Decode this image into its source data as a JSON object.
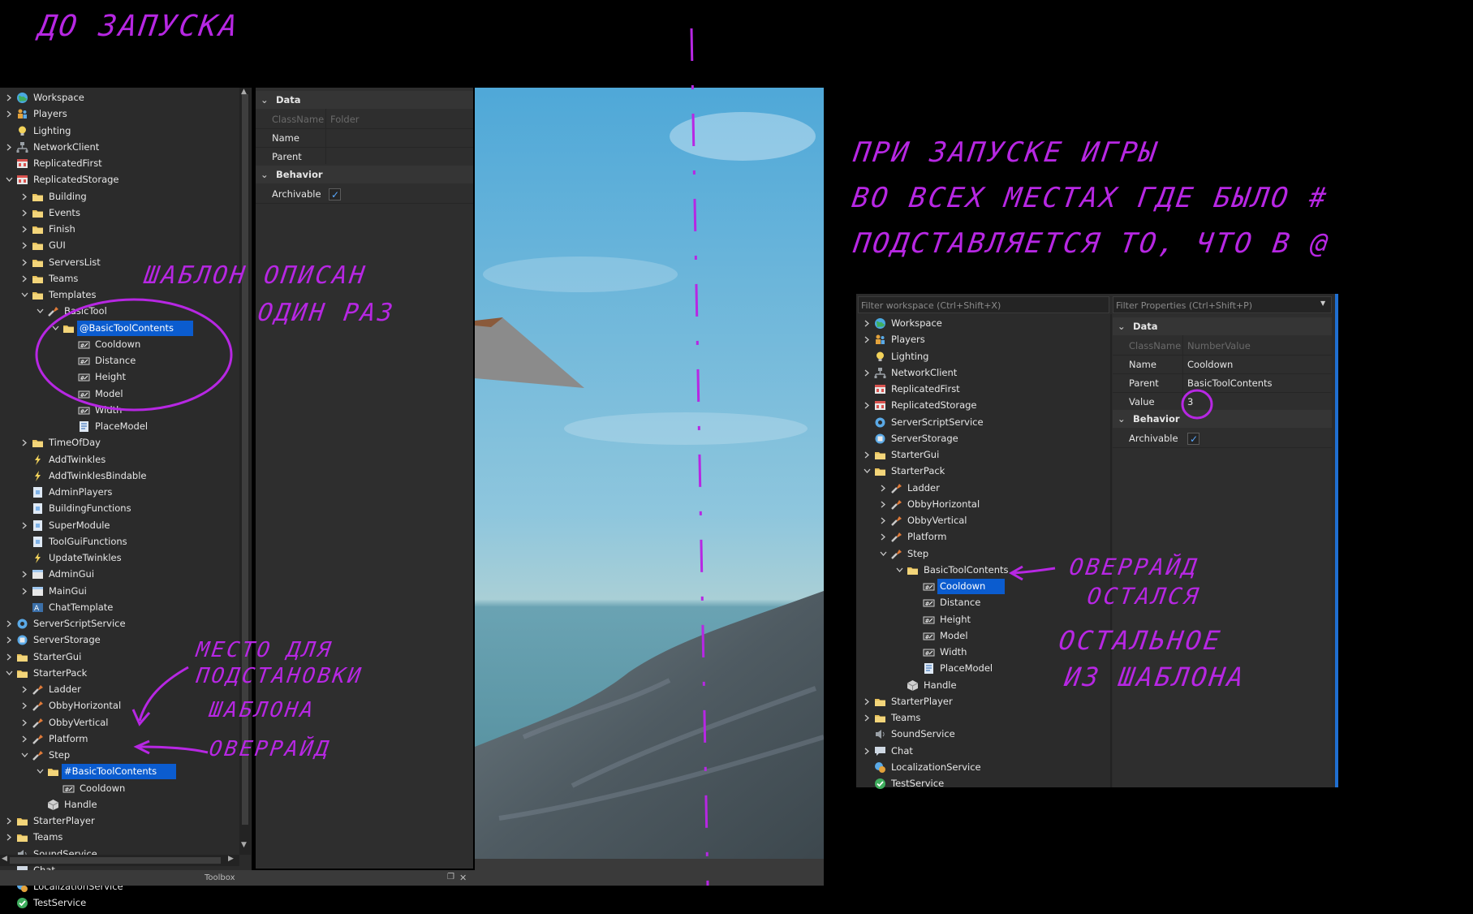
{
  "annotations": {
    "top_left": "ДО ЗАПУСКА",
    "right_line1": "ПРИ ЗАПУСКЕ ИГРЫ",
    "right_line2": "ВО ВСЕХ МЕСТАХ ГДЕ БЫЛО #",
    "right_line3": "ПОДСТАВЛЯЕТСЯ ТО, ЧТО В @",
    "template_note1": "ШАБЛОН ОПИСАН",
    "template_note2": "ОДИН РАЗ",
    "place_note1": "МЕСТО ДЛЯ",
    "place_note2": "ПОДСТАНОВКИ",
    "place_note3": "ШАБЛОНА",
    "override_note_left": "ОВЕРРАЙД",
    "override_right1": "ОВЕРРАЙД",
    "override_right2": "ОСТАЛСЯ",
    "override_right3": "ОСТАЛЬНОЕ",
    "override_right4": "ИЗ ШАБЛОНА"
  },
  "left_explorer": {
    "items": [
      {
        "label": "Workspace",
        "depth": 0,
        "arrow": "right",
        "icon": "globe-icon",
        "color": "#3fae5e"
      },
      {
        "label": "Players",
        "depth": 0,
        "arrow": "right",
        "icon": "players-icon",
        "color": "#e3a23c"
      },
      {
        "label": "Lighting",
        "depth": 0,
        "arrow": "none",
        "icon": "lightbulb-icon",
        "color": "#f2d25a"
      },
      {
        "label": "NetworkClient",
        "depth": 0,
        "arrow": "right",
        "icon": "network-icon",
        "color": "#9aa0a6"
      },
      {
        "label": "ReplicatedFirst",
        "depth": 0,
        "arrow": "none",
        "icon": "replicated-icon",
        "color": "#d9534f"
      },
      {
        "label": "ReplicatedStorage",
        "depth": 0,
        "arrow": "down",
        "icon": "replicated-icon",
        "color": "#d9534f"
      },
      {
        "label": "Building",
        "depth": 1,
        "arrow": "right",
        "icon": "folder-icon",
        "color": "#e8c15a"
      },
      {
        "label": "Events",
        "depth": 1,
        "arrow": "right",
        "icon": "folder-icon",
        "color": "#e8c15a"
      },
      {
        "label": "Finish",
        "depth": 1,
        "arrow": "right",
        "icon": "folder-icon",
        "color": "#e8c15a"
      },
      {
        "label": "GUI",
        "depth": 1,
        "arrow": "right",
        "icon": "folder-icon",
        "color": "#e8c15a"
      },
      {
        "label": "ServersList",
        "depth": 1,
        "arrow": "right",
        "icon": "folder-icon",
        "color": "#e8c15a"
      },
      {
        "label": "Teams",
        "depth": 1,
        "arrow": "right",
        "icon": "folder-icon",
        "color": "#e8c15a"
      },
      {
        "label": "Templates",
        "depth": 1,
        "arrow": "down",
        "icon": "folder-icon",
        "color": "#e8c15a"
      },
      {
        "label": "BasicTool",
        "depth": 2,
        "arrow": "down",
        "icon": "tool-icon",
        "color": "#e07b39"
      },
      {
        "label": "@BasicToolContents",
        "depth": 3,
        "arrow": "down",
        "icon": "folder-icon",
        "color": "#e8c15a",
        "selected": true
      },
      {
        "label": "Cooldown",
        "depth": 4,
        "arrow": "none",
        "icon": "number-value-icon",
        "color": "#cfcfcf"
      },
      {
        "label": "Distance",
        "depth": 4,
        "arrow": "none",
        "icon": "number-value-icon",
        "color": "#cfcfcf"
      },
      {
        "label": "Height",
        "depth": 4,
        "arrow": "none",
        "icon": "number-value-icon",
        "color": "#cfcfcf"
      },
      {
        "label": "Model",
        "depth": 4,
        "arrow": "none",
        "icon": "number-value-icon",
        "color": "#cfcfcf"
      },
      {
        "label": "Width",
        "depth": 4,
        "arrow": "none",
        "icon": "number-value-icon",
        "color": "#cfcfcf"
      },
      {
        "label": "PlaceModel",
        "depth": 4,
        "arrow": "none",
        "icon": "script-icon",
        "color": "#7fb3e8"
      },
      {
        "label": "TimeOfDay",
        "depth": 1,
        "arrow": "right",
        "icon": "folder-icon",
        "color": "#e8c15a"
      },
      {
        "label": "AddTwinkles",
        "depth": 1,
        "arrow": "none",
        "icon": "bindable-icon",
        "color": "#f2d25a"
      },
      {
        "label": "AddTwinklesBindable",
        "depth": 1,
        "arrow": "none",
        "icon": "bindable-icon",
        "color": "#f2d25a"
      },
      {
        "label": "AdminPlayers",
        "depth": 1,
        "arrow": "none",
        "icon": "module-icon",
        "color": "#7fb3e8"
      },
      {
        "label": "BuildingFunctions",
        "depth": 1,
        "arrow": "none",
        "icon": "module-icon",
        "color": "#7fb3e8"
      },
      {
        "label": "SuperModule",
        "depth": 1,
        "arrow": "right",
        "icon": "module-icon",
        "color": "#7fb3e8"
      },
      {
        "label": "ToolGuiFunctions",
        "depth": 1,
        "arrow": "none",
        "icon": "module-icon",
        "color": "#7fb3e8"
      },
      {
        "label": "UpdateTwinkles",
        "depth": 1,
        "arrow": "none",
        "icon": "bindable-icon",
        "color": "#f2d25a"
      },
      {
        "label": "AdminGui",
        "depth": 1,
        "arrow": "right",
        "icon": "screen-gui-icon",
        "color": "#9fc7ef"
      },
      {
        "label": "MainGui",
        "depth": 1,
        "arrow": "right",
        "icon": "screen-gui-icon",
        "color": "#9fc7ef"
      },
      {
        "label": "ChatTemplate",
        "depth": 1,
        "arrow": "none",
        "icon": "text-icon",
        "color": "#9fc7ef"
      },
      {
        "label": "ServerScriptService",
        "depth": 0,
        "arrow": "right",
        "icon": "server-script-icon",
        "color": "#5aa9e6"
      },
      {
        "label": "ServerStorage",
        "depth": 0,
        "arrow": "right",
        "icon": "server-storage-icon",
        "color": "#5aa9e6"
      },
      {
        "label": "StarterGui",
        "depth": 0,
        "arrow": "right",
        "icon": "folder-icon",
        "color": "#e8c15a"
      },
      {
        "label": "StarterPack",
        "depth": 0,
        "arrow": "down",
        "icon": "folder-icon",
        "color": "#e8c15a"
      },
      {
        "label": "Ladder",
        "depth": 1,
        "arrow": "right",
        "icon": "tool-icon",
        "color": "#e07b39"
      },
      {
        "label": "ObbyHorizontal",
        "depth": 1,
        "arrow": "right",
        "icon": "tool-icon",
        "color": "#e07b39"
      },
      {
        "label": "ObbyVertical",
        "depth": 1,
        "arrow": "right",
        "icon": "tool-icon",
        "color": "#e07b39"
      },
      {
        "label": "Platform",
        "depth": 1,
        "arrow": "right",
        "icon": "tool-icon",
        "color": "#e07b39"
      },
      {
        "label": "Step",
        "depth": 1,
        "arrow": "down",
        "icon": "tool-icon",
        "color": "#e07b39"
      },
      {
        "label": "#BasicToolContents",
        "depth": 2,
        "arrow": "down",
        "icon": "folder-icon",
        "color": "#e8c15a",
        "selected": true
      },
      {
        "label": "Cooldown",
        "depth": 3,
        "arrow": "none",
        "icon": "number-value-icon",
        "color": "#cfcfcf"
      },
      {
        "label": "Handle",
        "depth": 2,
        "arrow": "none",
        "icon": "part-icon",
        "color": "#d0d0d0"
      },
      {
        "label": "StarterPlayer",
        "depth": 0,
        "arrow": "right",
        "icon": "folder-icon",
        "color": "#e8c15a"
      },
      {
        "label": "Teams",
        "depth": 0,
        "arrow": "right",
        "icon": "folder-icon",
        "color": "#e8c15a"
      },
      {
        "label": "SoundService",
        "depth": 0,
        "arrow": "none",
        "icon": "sound-icon",
        "color": "#9aa0a6"
      },
      {
        "label": "Chat",
        "depth": 0,
        "arrow": "none",
        "icon": "chat-icon",
        "color": "#cfd8e3"
      },
      {
        "label": "LocalizationService",
        "depth": 0,
        "arrow": "none",
        "icon": "localization-icon",
        "color": "#5aa9e6"
      },
      {
        "label": "TestService",
        "depth": 0,
        "arrow": "none",
        "icon": "check-circle-icon",
        "color": "#3fae5e"
      }
    ],
    "toolbox_label": "Toolbox"
  },
  "left_properties": {
    "data_header": "Data",
    "rows": [
      {
        "key": "ClassName",
        "value": "Folder",
        "dim": true
      },
      {
        "key": "Name",
        "value": "",
        "dim": false
      },
      {
        "key": "Parent",
        "value": "",
        "dim": false
      }
    ],
    "behavior_header": "Behavior",
    "archivable_label": "Archivable"
  },
  "right_explorer": {
    "filter_placeholder": "Filter workspace (Ctrl+Shift+X)",
    "items": [
      {
        "label": "Workspace",
        "depth": 0,
        "arrow": "right",
        "icon": "globe-icon",
        "color": "#3fae5e"
      },
      {
        "label": "Players",
        "depth": 0,
        "arrow": "right",
        "icon": "players-icon",
        "color": "#e3a23c"
      },
      {
        "label": "Lighting",
        "depth": 0,
        "arrow": "none",
        "icon": "lightbulb-icon",
        "color": "#f2d25a"
      },
      {
        "label": "NetworkClient",
        "depth": 0,
        "arrow": "right",
        "icon": "network-icon",
        "color": "#9aa0a6"
      },
      {
        "label": "ReplicatedFirst",
        "depth": 0,
        "arrow": "none",
        "icon": "replicated-icon",
        "color": "#d9534f"
      },
      {
        "label": "ReplicatedStorage",
        "depth": 0,
        "arrow": "right",
        "icon": "replicated-icon",
        "color": "#d9534f"
      },
      {
        "label": "ServerScriptService",
        "depth": 0,
        "arrow": "none",
        "icon": "server-script-icon",
        "color": "#5aa9e6"
      },
      {
        "label": "ServerStorage",
        "depth": 0,
        "arrow": "none",
        "icon": "server-storage-icon",
        "color": "#5aa9e6"
      },
      {
        "label": "StarterGui",
        "depth": 0,
        "arrow": "right",
        "icon": "folder-icon",
        "color": "#e8c15a"
      },
      {
        "label": "StarterPack",
        "depth": 0,
        "arrow": "down",
        "icon": "folder-icon",
        "color": "#e8c15a"
      },
      {
        "label": "Ladder",
        "depth": 1,
        "arrow": "right",
        "icon": "tool-icon",
        "color": "#e07b39"
      },
      {
        "label": "ObbyHorizontal",
        "depth": 1,
        "arrow": "right",
        "icon": "tool-icon",
        "color": "#e07b39"
      },
      {
        "label": "ObbyVertical",
        "depth": 1,
        "arrow": "right",
        "icon": "tool-icon",
        "color": "#e07b39"
      },
      {
        "label": "Platform",
        "depth": 1,
        "arrow": "right",
        "icon": "tool-icon",
        "color": "#e07b39"
      },
      {
        "label": "Step",
        "depth": 1,
        "arrow": "down",
        "icon": "tool-icon",
        "color": "#e07b39"
      },
      {
        "label": "BasicToolContents",
        "depth": 2,
        "arrow": "down",
        "icon": "folder-icon",
        "color": "#e8c15a"
      },
      {
        "label": "Cooldown",
        "depth": 3,
        "arrow": "none",
        "icon": "number-value-icon",
        "color": "#cfcfcf",
        "selected": true
      },
      {
        "label": "Distance",
        "depth": 3,
        "arrow": "none",
        "icon": "number-value-icon",
        "color": "#cfcfcf"
      },
      {
        "label": "Height",
        "depth": 3,
        "arrow": "none",
        "icon": "number-value-icon",
        "color": "#cfcfcf"
      },
      {
        "label": "Model",
        "depth": 3,
        "arrow": "none",
        "icon": "number-value-icon",
        "color": "#cfcfcf"
      },
      {
        "label": "Width",
        "depth": 3,
        "arrow": "none",
        "icon": "number-value-icon",
        "color": "#cfcfcf"
      },
      {
        "label": "PlaceModel",
        "depth": 3,
        "arrow": "none",
        "icon": "script-icon",
        "color": "#7fb3e8"
      },
      {
        "label": "Handle",
        "depth": 2,
        "arrow": "none",
        "icon": "part-icon",
        "color": "#d0d0d0"
      },
      {
        "label": "StarterPlayer",
        "depth": 0,
        "arrow": "right",
        "icon": "folder-icon",
        "color": "#e8c15a"
      },
      {
        "label": "Teams",
        "depth": 0,
        "arrow": "right",
        "icon": "folder-icon",
        "color": "#e8c15a"
      },
      {
        "label": "SoundService",
        "depth": 0,
        "arrow": "none",
        "icon": "sound-icon",
        "color": "#9aa0a6"
      },
      {
        "label": "Chat",
        "depth": 0,
        "arrow": "right",
        "icon": "chat-icon",
        "color": "#cfd8e3"
      },
      {
        "label": "LocalizationService",
        "depth": 0,
        "arrow": "none",
        "icon": "localization-icon",
        "color": "#5aa9e6"
      },
      {
        "label": "TestService",
        "depth": 0,
        "arrow": "none",
        "icon": "check-circle-icon",
        "color": "#3fae5e"
      }
    ]
  },
  "right_properties": {
    "filter_placeholder": "Filter Properties (Ctrl+Shift+P)",
    "data_header": "Data",
    "rows": [
      {
        "key": "ClassName",
        "value": "NumberValue",
        "dim": true
      },
      {
        "key": "Name",
        "value": "Cooldown",
        "dim": false
      },
      {
        "key": "Parent",
        "value": "BasicToolContents",
        "dim": false
      },
      {
        "key": "Value",
        "value": "3",
        "dim": false
      }
    ],
    "behavior_header": "Behavior",
    "archivable_label": "Archivable"
  },
  "colors": {
    "selection": "#0b5ccf",
    "annotation": "#b727e3",
    "panel_bg": "#2e2e2e"
  }
}
